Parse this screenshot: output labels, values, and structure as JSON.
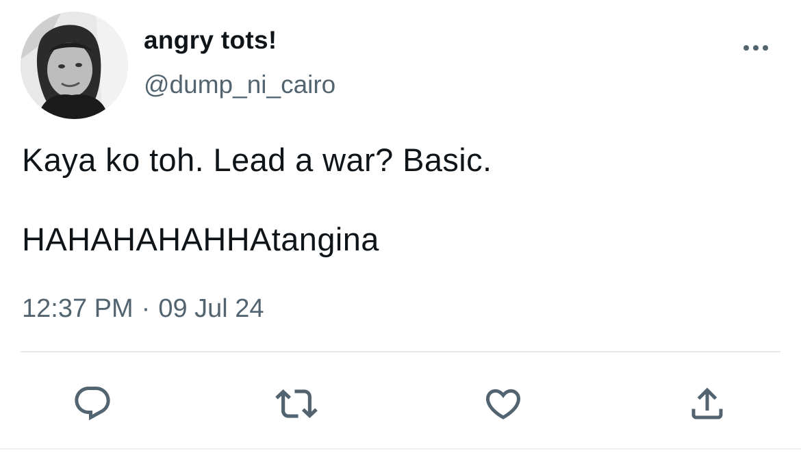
{
  "user": {
    "display_name": "angry tots!",
    "handle": "@dump_ni_cairo"
  },
  "tweet": {
    "line1": "Kaya ko toh. Lead a war? Basic.",
    "line2": "HAHAHAHAHHAtangina"
  },
  "meta": {
    "time": "12:37 PM",
    "separator": "·",
    "date": "09 Jul 24"
  },
  "icons": {
    "more": "more-horizontal-icon",
    "reply": "reply-icon",
    "retweet": "retweet-icon",
    "like": "heart-icon",
    "share": "share-icon"
  },
  "colors": {
    "text_primary": "#0f1419",
    "text_secondary": "#536471",
    "icon": "#536471",
    "divider": "#e6e9eb"
  }
}
